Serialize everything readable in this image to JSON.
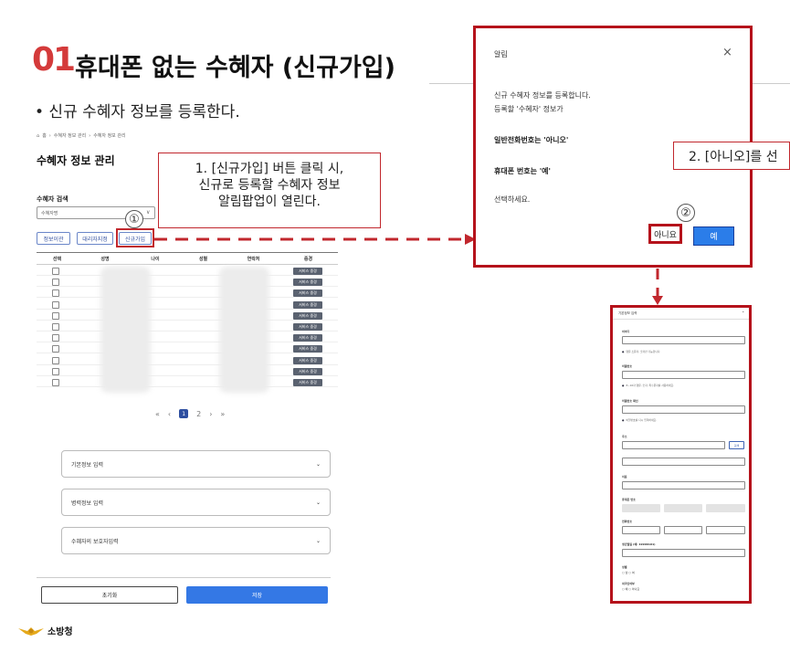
{
  "slide": {
    "number": "01",
    "title": "휴대폰 없는 수혜자 (신규가입)",
    "bullet": "• 신규 수혜자 정보를 등록한다.",
    "logo_text": "소방청"
  },
  "screen": {
    "breadcrumb": [
      "홈",
      "수혜자 정보 관리",
      "수혜자 정보 관리"
    ],
    "page_title": "수혜자 정보 관리",
    "search_label": "수혜자 검색",
    "search_placeholder": "수혜자명",
    "buttons": {
      "info_transfer": "정보이관",
      "proxy_designate": "대리자지정",
      "new_signup": "신규가입"
    },
    "table": {
      "headers": [
        "선택",
        "성명",
        "나이",
        "성별",
        "연락처",
        "중경"
      ],
      "row_action": "서비스 중경",
      "row_count": 11
    },
    "pagination": {
      "first": "«",
      "prev": "‹",
      "current": "1",
      "page2": "2",
      "next": "›",
      "last": "»"
    },
    "accordions": [
      "기본정보 입력",
      "병력정보 입력",
      "수혜자의 보호자입력"
    ],
    "reset_label": "초기화",
    "save_label": "저장"
  },
  "annotations": {
    "callout1_lines": [
      "1. [신규가입] 버튼 클릭 시,",
      "신규로 등록할 수혜자 정보",
      "알림팝업이 열린다."
    ],
    "step1": "①",
    "step2": "②",
    "callout2": "2. [아니오]를 선"
  },
  "dialog": {
    "title": "알림",
    "close": "×",
    "line1": "신규 수혜자 정보를 등록합니다.",
    "line2": "등록할 '수혜자' 정보가",
    "line3": "일반전화번호는 '아니오'",
    "line4": "휴대폰 번호는 '예'",
    "line5": "선택하세요.",
    "no_label": "아니요",
    "yes_label": "예"
  },
  "form_preview": {
    "header": "기본정보 입력",
    "fields": [
      "아이디",
      "비밀번호",
      "비밀번호 확인",
      "주소",
      "이름",
      "휴대폰 번호",
      "전화번호",
      "생년월일 (예: 19990101)",
      "성별",
      "외국인여부"
    ],
    "notes": [
      "영문 소문자, 숫자만 가능합니다.",
      "8~16자 영문, 숫자, 특수문자를 사용하세요.",
      "비밀번호를 다시 입력하세요."
    ],
    "address_btn": "검색",
    "gender_options": "○ 남 ○ 여",
    "foreign_options": "○ 예 ○ 아니요"
  },
  "colors": {
    "accent_red": "#c1272d",
    "primary_blue": "#3478e5",
    "number_red": "#d43a3a"
  }
}
